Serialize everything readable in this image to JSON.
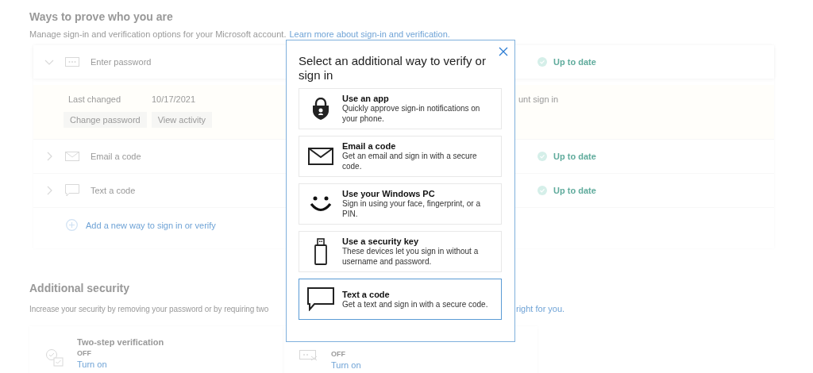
{
  "section_1": {
    "title": "Ways to prove who you are",
    "description": "Manage sign-in and verification options for your Microsoft account.",
    "link": "Learn more about sign-in and verification."
  },
  "methods": [
    {
      "label": "Enter password",
      "kind": "password",
      "expanded": true,
      "status": "Up to date",
      "details": {
        "last_changed_label": "Last changed",
        "last_changed_value": "10/17/2021",
        "note_fragment": "unt sign in",
        "buttons": [
          "Change password",
          "View activity"
        ]
      }
    },
    {
      "label": "Email a code",
      "kind": "email",
      "expanded": false,
      "status": "Up to date"
    },
    {
      "label": "Text a code",
      "kind": "text",
      "expanded": false,
      "status": "Up to date"
    }
  ],
  "add_method": "Add a new way to sign in or verify",
  "section_2": {
    "title": "Additional security",
    "description_fragment": "Increase your security by removing your password or by requiring two",
    "description_tail": "right for you.",
    "cards": [
      {
        "kind": "two-step",
        "title": "Two-step verification",
        "status": "OFF",
        "action": "Turn on"
      },
      {
        "kind": "passwordless",
        "status": "OFF",
        "action": "Turn on"
      }
    ]
  },
  "dialog": {
    "title": "Select an additional way to verify or sign in",
    "options": [
      {
        "kind": "app",
        "title": "Use an app",
        "description": "Quickly approve sign-in notifications on your phone.",
        "selected": false
      },
      {
        "kind": "email",
        "title": "Email a code",
        "description": "Get an email and sign in with a secure code.",
        "selected": false
      },
      {
        "kind": "pc",
        "title": "Use your Windows PC",
        "description": "Sign in using your face, fingerprint, or a PIN.",
        "selected": false
      },
      {
        "kind": "key",
        "title": "Use a security key",
        "description": "These devices let you sign in without a username and password.",
        "selected": false
      },
      {
        "kind": "text",
        "title": "Text a code",
        "description": "Get a text and sign in with a secure code.",
        "selected": true
      }
    ]
  }
}
